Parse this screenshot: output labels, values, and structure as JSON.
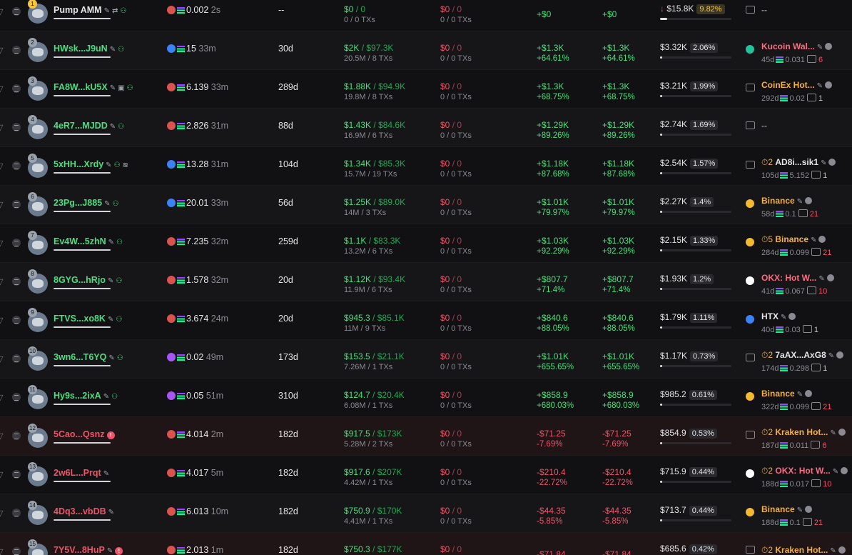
{
  "rows": [
    {
      "rank": "1",
      "name": "Pump AMM",
      "name_color": "white",
      "badges": [
        "edit",
        "swap",
        "user"
      ],
      "src": "pump",
      "src_color": "#d9534f",
      "bal": "0.002",
      "bal_time": "2s",
      "age": "--",
      "bought": "$0",
      "bought_total": "0",
      "bought_sub": "0 / 0 TXs",
      "sold": "$0",
      "sold_total": "0",
      "sold_sub": "0 / 0 TXs",
      "pnl": "+$0",
      "pnl_pct": "",
      "upnl": "+$0",
      "upnl_pct": "",
      "pnl_color": "green",
      "hold": "$15.8K",
      "hold_pct": "9.82%",
      "hold_arrow": "↓",
      "hold_fill": 0.1,
      "fund_type": "box",
      "fund_name": "--",
      "fund_name_color": "gray",
      "fund_age": "",
      "fund_sol": "",
      "fund_count": "",
      "fund_count_color": "",
      "prefix": ""
    },
    {
      "rank": "2",
      "name": "HWsk...J9uN",
      "name_color": "green",
      "badges": [
        "edit",
        "user"
      ],
      "src": "eye",
      "src_color": "#3b82f6",
      "bal": "15",
      "bal_time": "33m",
      "age": "30d",
      "bought": "$2K",
      "bought_total": "$97.3K",
      "bought_sub": "20.5M / 8 TXs",
      "sold": "$0",
      "sold_total": "0",
      "sold_sub": "0 / 0 TXs",
      "pnl": "+$1.3K",
      "pnl_pct": "+64.61%",
      "upnl": "+$1.3K",
      "upnl_pct": "+64.61%",
      "pnl_color": "green",
      "hold": "$3.32K",
      "hold_pct": "2.06%",
      "hold_arrow": "",
      "hold_fill": 0.02,
      "fund_type": "kucoin",
      "fund_name": "Kucoin Wal...",
      "fund_name_color": "pink",
      "fund_age": "45d",
      "fund_sol": "0.031",
      "fund_count": "6",
      "fund_count_color": "red",
      "prefix": ""
    },
    {
      "rank": "3",
      "name": "FA8W...kU5X",
      "name_color": "green",
      "badges": [
        "edit",
        "bot",
        "user"
      ],
      "src": "pump",
      "src_color": "#d9534f",
      "bal": "6.139",
      "bal_time": "33m",
      "age": "289d",
      "bought": "$1.88K",
      "bought_total": "$94.9K",
      "bought_sub": "19.8M / 8 TXs",
      "sold": "$0",
      "sold_total": "0",
      "sold_sub": "0 / 0 TXs",
      "pnl": "+$1.3K",
      "pnl_pct": "+68.75%",
      "upnl": "+$1.3K",
      "upnl_pct": "+68.75%",
      "pnl_color": "green",
      "hold": "$3.21K",
      "hold_pct": "1.99%",
      "hold_arrow": "",
      "hold_fill": 0.02,
      "fund_type": "box",
      "fund_name": "CoinEx Hot...",
      "fund_name_color": "orange",
      "fund_age": "292d",
      "fund_sol": "0.02",
      "fund_count": "1",
      "fund_count_color": "white",
      "prefix": ""
    },
    {
      "rank": "4",
      "name": "4eR7...MJDD",
      "name_color": "green",
      "badges": [
        "edit",
        "user"
      ],
      "src": "pump",
      "src_color": "#d9534f",
      "bal": "2.826",
      "bal_time": "31m",
      "age": "88d",
      "bought": "$1.43K",
      "bought_total": "$84.6K",
      "bought_sub": "16.9M / 6 TXs",
      "sold": "$0",
      "sold_total": "0",
      "sold_sub": "0 / 0 TXs",
      "pnl": "+$1.29K",
      "pnl_pct": "+89.26%",
      "upnl": "+$1.29K",
      "upnl_pct": "+89.26%",
      "pnl_color": "green",
      "hold": "$2.74K",
      "hold_pct": "1.69%",
      "hold_arrow": "",
      "hold_fill": 0.017,
      "fund_type": "box",
      "fund_name": "--",
      "fund_name_color": "gray",
      "fund_age": "",
      "fund_sol": "",
      "fund_count": "",
      "fund_count_color": "",
      "prefix": ""
    },
    {
      "rank": "5",
      "name": "5xHH...Xrdy",
      "name_color": "green",
      "badges": [
        "edit",
        "user",
        "layers"
      ],
      "src": "eye",
      "src_color": "#3b82f6",
      "bal": "13.28",
      "bal_time": "31m",
      "age": "104d",
      "bought": "$1.34K",
      "bought_total": "$85.3K",
      "bought_sub": "15.7M / 19 TXs",
      "sold": "$0",
      "sold_total": "0",
      "sold_sub": "0 / 0 TXs",
      "pnl": "+$1.18K",
      "pnl_pct": "+87.68%",
      "upnl": "+$1.18K",
      "upnl_pct": "+87.68%",
      "pnl_color": "green",
      "hold": "$2.54K",
      "hold_pct": "1.57%",
      "hold_arrow": "",
      "hold_fill": 0.016,
      "fund_type": "box",
      "fund_name": "AD8i...sik1",
      "fund_name_color": "white",
      "fund_age": "105d",
      "fund_sol": "5.152",
      "fund_count": "1",
      "fund_count_color": "white",
      "prefix": "⏱2"
    },
    {
      "rank": "6",
      "name": "23Pg...J885",
      "name_color": "green",
      "badges": [
        "edit",
        "user"
      ],
      "src": "eye",
      "src_color": "#3b82f6",
      "bal": "20.01",
      "bal_time": "33m",
      "age": "56d",
      "bought": "$1.25K",
      "bought_total": "$89.0K",
      "bought_sub": "14M / 3 TXs",
      "sold": "$0",
      "sold_total": "0",
      "sold_sub": "0 / 0 TXs",
      "pnl": "+$1.01K",
      "pnl_pct": "+79.97%",
      "upnl": "+$1.01K",
      "upnl_pct": "+79.97%",
      "pnl_color": "green",
      "hold": "$2.27K",
      "hold_pct": "1.4%",
      "hold_arrow": "",
      "hold_fill": 0.014,
      "fund_type": "binance",
      "fund_name": "Binance",
      "fund_name_color": "orange",
      "fund_age": "58d",
      "fund_sol": "0.1",
      "fund_count": "21",
      "fund_count_color": "red",
      "prefix": ""
    },
    {
      "rank": "7",
      "name": "Ev4W...5zhN",
      "name_color": "green",
      "badges": [
        "edit",
        "user"
      ],
      "src": "pump",
      "src_color": "#d9534f",
      "bal": "7.235",
      "bal_time": "32m",
      "age": "259d",
      "bought": "$1.1K",
      "bought_total": "$83.3K",
      "bought_sub": "13.2M / 6 TXs",
      "sold": "$0",
      "sold_total": "0",
      "sold_sub": "0 / 0 TXs",
      "pnl": "+$1.03K",
      "pnl_pct": "+92.29%",
      "upnl": "+$1.03K",
      "upnl_pct": "+92.29%",
      "pnl_color": "green",
      "hold": "$2.15K",
      "hold_pct": "1.33%",
      "hold_arrow": "",
      "hold_fill": 0.013,
      "fund_type": "binance",
      "fund_name": "Binance",
      "fund_name_color": "orange",
      "fund_age": "284d",
      "fund_sol": "0.099",
      "fund_count": "21",
      "fund_count_color": "red",
      "prefix": "⏱5"
    },
    {
      "rank": "8",
      "name": "8GYG...hRjo",
      "name_color": "green",
      "badges": [
        "edit",
        "user"
      ],
      "src": "pump",
      "src_color": "#d9534f",
      "bal": "1.578",
      "bal_time": "32m",
      "age": "20d",
      "bought": "$1.12K",
      "bought_total": "$93.4K",
      "bought_sub": "11.9M / 6 TXs",
      "sold": "$0",
      "sold_total": "0",
      "sold_sub": "0 / 0 TXs",
      "pnl": "+$807.7",
      "pnl_pct": "+71.4%",
      "upnl": "+$807.7",
      "upnl_pct": "+71.4%",
      "pnl_color": "green",
      "hold": "$1.93K",
      "hold_pct": "1.2%",
      "hold_arrow": "",
      "hold_fill": 0.012,
      "fund_type": "okx",
      "fund_name": "OKX: Hot W...",
      "fund_name_color": "pink",
      "fund_age": "41d",
      "fund_sol": "0.067",
      "fund_count": "10",
      "fund_count_color": "red",
      "prefix": ""
    },
    {
      "rank": "9",
      "name": "FTVS...xo8K",
      "name_color": "green",
      "badges": [
        "edit",
        "user"
      ],
      "src": "pump",
      "src_color": "#d9534f",
      "bal": "3.674",
      "bal_time": "24m",
      "age": "20d",
      "bought": "$945.3",
      "bought_total": "$85.1K",
      "bought_sub": "11M / 9 TXs",
      "sold": "$0",
      "sold_total": "0",
      "sold_sub": "0 / 0 TXs",
      "pnl": "+$840.6",
      "pnl_pct": "+88.05%",
      "upnl": "+$840.6",
      "upnl_pct": "+88.05%",
      "pnl_color": "green",
      "hold": "$1.79K",
      "hold_pct": "1.11%",
      "hold_arrow": "",
      "hold_fill": 0.011,
      "fund_type": "htx",
      "fund_name": "HTX",
      "fund_name_color": "white",
      "fund_age": "40d",
      "fund_sol": "0.03",
      "fund_count": "1",
      "fund_count_color": "white",
      "prefix": ""
    },
    {
      "rank": "10",
      "name": "3wn6...T6YQ",
      "name_color": "green",
      "badges": [
        "edit",
        "user"
      ],
      "src": "pump2",
      "src_color": "#a855f7",
      "bal": "0.02",
      "bal_time": "49m",
      "age": "173d",
      "bought": "$153.5",
      "bought_total": "$21.1K",
      "bought_sub": "7.26M / 1 TXs",
      "sold": "$0",
      "sold_total": "0",
      "sold_sub": "0 / 0 TXs",
      "pnl": "+$1.01K",
      "pnl_pct": "+655.65%",
      "upnl": "+$1.01K",
      "upnl_pct": "+655.65%",
      "pnl_color": "green",
      "hold": "$1.17K",
      "hold_pct": "0.73%",
      "hold_arrow": "",
      "hold_fill": 0.007,
      "fund_type": "box",
      "fund_name": "7aAX...AxG8",
      "fund_name_color": "white",
      "fund_age": "174d",
      "fund_sol": "0.298",
      "fund_count": "1",
      "fund_count_color": "white",
      "prefix": "⏱2"
    },
    {
      "rank": "11",
      "name": "Hy9s...2ixA",
      "name_color": "green",
      "badges": [
        "edit",
        "user"
      ],
      "src": "pump2",
      "src_color": "#a855f7",
      "bal": "0.05",
      "bal_time": "51m",
      "age": "310d",
      "bought": "$124.7",
      "bought_total": "$20.4K",
      "bought_sub": "6.08M / 1 TXs",
      "sold": "$0",
      "sold_total": "0",
      "sold_sub": "0 / 0 TXs",
      "pnl": "+$858.9",
      "pnl_pct": "+680.03%",
      "upnl": "+$858.9",
      "upnl_pct": "+680.03%",
      "pnl_color": "green",
      "hold": "$985.2",
      "hold_pct": "0.61%",
      "hold_arrow": "",
      "hold_fill": 0.006,
      "fund_type": "binance",
      "fund_name": "Binance",
      "fund_name_color": "orange",
      "fund_age": "322d",
      "fund_sol": "0.099",
      "fund_count": "21",
      "fund_count_color": "red",
      "prefix": ""
    },
    {
      "rank": "12",
      "name": "5Cao...Qsnz",
      "name_color": "red",
      "badges": [
        "alert"
      ],
      "src": "pump",
      "src_color": "#d9534f",
      "bal": "4.014",
      "bal_time": "2m",
      "age": "182d",
      "bought": "$917.5",
      "bought_total": "$173K",
      "bought_sub": "5.28M / 2 TXs",
      "sold": "$0",
      "sold_total": "0",
      "sold_sub": "0 / 0 TXs",
      "pnl": "-$71.25",
      "pnl_pct": "-7.69%",
      "upnl": "-$71.25",
      "upnl_pct": "-7.69%",
      "pnl_color": "red",
      "hold": "$854.9",
      "hold_pct": "0.53%",
      "hold_arrow": "",
      "hold_fill": 0.005,
      "fund_type": "box",
      "fund_name": "Kraken Hot...",
      "fund_name_color": "orange",
      "fund_age": "187d",
      "fund_sol": "0.011",
      "fund_count": "6",
      "fund_count_color": "red",
      "prefix": "⏱2",
      "red_row": true
    },
    {
      "rank": "13",
      "name": "2w6L...Prqt",
      "name_color": "red",
      "badges": [
        "edit"
      ],
      "src": "pump",
      "src_color": "#d9534f",
      "bal": "4.017",
      "bal_time": "5m",
      "age": "182d",
      "bought": "$917.6",
      "bought_total": "$207K",
      "bought_sub": "4.42M / 1 TXs",
      "sold": "$0",
      "sold_total": "0",
      "sold_sub": "0 / 0 TXs",
      "pnl": "-$210.4",
      "pnl_pct": "-22.72%",
      "upnl": "-$210.4",
      "upnl_pct": "-22.72%",
      "pnl_color": "red",
      "hold": "$715.9",
      "hold_pct": "0.44%",
      "hold_arrow": "",
      "hold_fill": 0.0044,
      "fund_type": "okx",
      "fund_name": "OKX: Hot W...",
      "fund_name_color": "pink",
      "fund_age": "188d",
      "fund_sol": "0.017",
      "fund_count": "10",
      "fund_count_color": "red",
      "prefix": "⏱2"
    },
    {
      "rank": "14",
      "name": "4Dq3...vbDB",
      "name_color": "red",
      "badges": [
        "edit"
      ],
      "src": "pump",
      "src_color": "#d9534f",
      "bal": "6.013",
      "bal_time": "10m",
      "age": "182d",
      "bought": "$750.9",
      "bought_total": "$170K",
      "bought_sub": "4.41M / 1 TXs",
      "sold": "$0",
      "sold_total": "0",
      "sold_sub": "0 / 0 TXs",
      "pnl": "-$44.35",
      "pnl_pct": "-5.85%",
      "upnl": "-$44.35",
      "upnl_pct": "-5.85%",
      "pnl_color": "red",
      "hold": "$713.7",
      "hold_pct": "0.44%",
      "hold_arrow": "",
      "hold_fill": 0.0044,
      "fund_type": "binance",
      "fund_name": "Binance",
      "fund_name_color": "orange",
      "fund_age": "188d",
      "fund_sol": "0.1",
      "fund_count": "21",
      "fund_count_color": "red",
      "prefix": ""
    },
    {
      "rank": "15",
      "name": "7Y5V...8HuP",
      "name_color": "red",
      "badges": [
        "edit",
        "alert"
      ],
      "src": "pump",
      "src_color": "#d9534f",
      "bal": "2.013",
      "bal_time": "1m",
      "age": "182d",
      "bought": "$750.3",
      "bought_total": "$177K",
      "bought_sub": "",
      "sold": "$0",
      "sold_total": "0",
      "sold_sub": "",
      "pnl": "-$71.84",
      "pnl_pct": "",
      "upnl": "-$71.84",
      "upnl_pct": "",
      "pnl_color": "red",
      "hold": "$685.6",
      "hold_pct": "0.42%",
      "hold_arrow": "",
      "hold_fill": 0.0042,
      "fund_type": "box",
      "fund_name": "Kraken Hot...",
      "fund_name_color": "orange",
      "fund_age": "",
      "fund_sol": "",
      "fund_count": "",
      "fund_count_color": "",
      "prefix": "⏱2",
      "red_row": true
    }
  ]
}
